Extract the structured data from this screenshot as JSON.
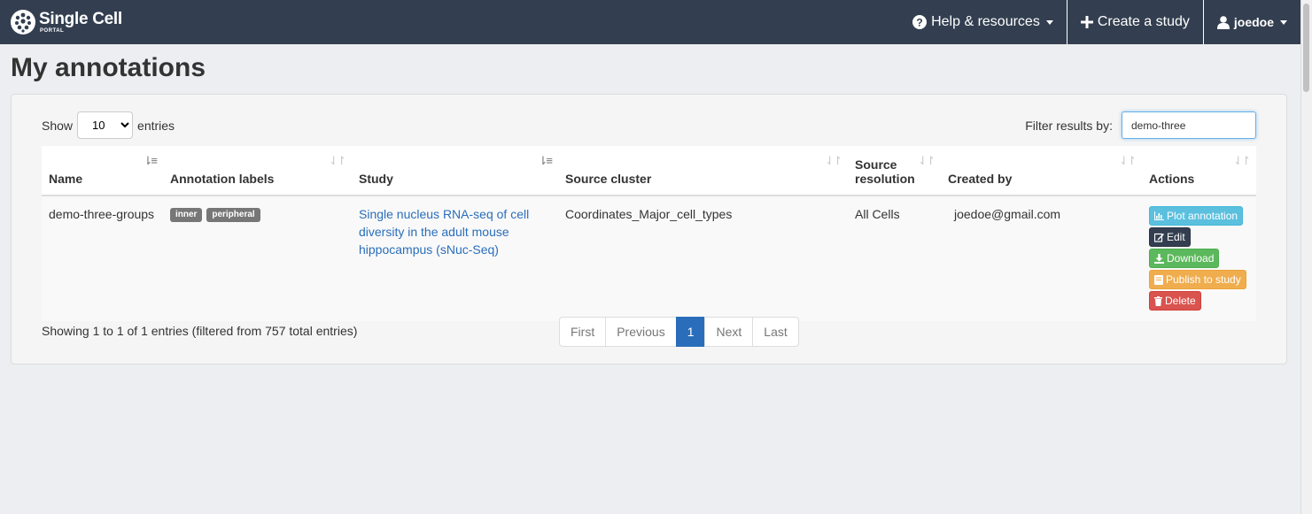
{
  "navbar": {
    "brand_name": "Single Cell",
    "brand_sub": "PORTAL",
    "help_label": "Help & resources",
    "create_label": "Create a study",
    "user_label": "joedoe"
  },
  "page": {
    "title": "My annotations"
  },
  "controls": {
    "show_label": "Show",
    "entries_label": "entries",
    "entries_value": "10",
    "filter_label": "Filter results by:",
    "filter_value": "demo-three"
  },
  "table": {
    "headers": [
      "Name",
      "Annotation labels",
      "Study",
      "Source cluster",
      "Source resolution",
      "Created by",
      "Actions"
    ],
    "rows": [
      {
        "name": "demo-three-groups",
        "labels": [
          "inner",
          "peripheral"
        ],
        "study": "Single nucleus RNA-seq of cell diversity in the adult mouse hippocampus (sNuc-Seq)",
        "source_cluster": "Coordinates_Major_cell_types",
        "source_resolution": "All Cells",
        "created_by": "joedoe@gmail.com",
        "actions": {
          "plot": "Plot annotation",
          "edit": "Edit",
          "download": "Download",
          "publish": "Publish to study",
          "delete": "Delete"
        }
      }
    ]
  },
  "footer": {
    "info": "Showing 1 to 1 of 1 entries (filtered from 757 total entries)",
    "pages": [
      "First",
      "Previous",
      "1",
      "Next",
      "Last"
    ]
  }
}
